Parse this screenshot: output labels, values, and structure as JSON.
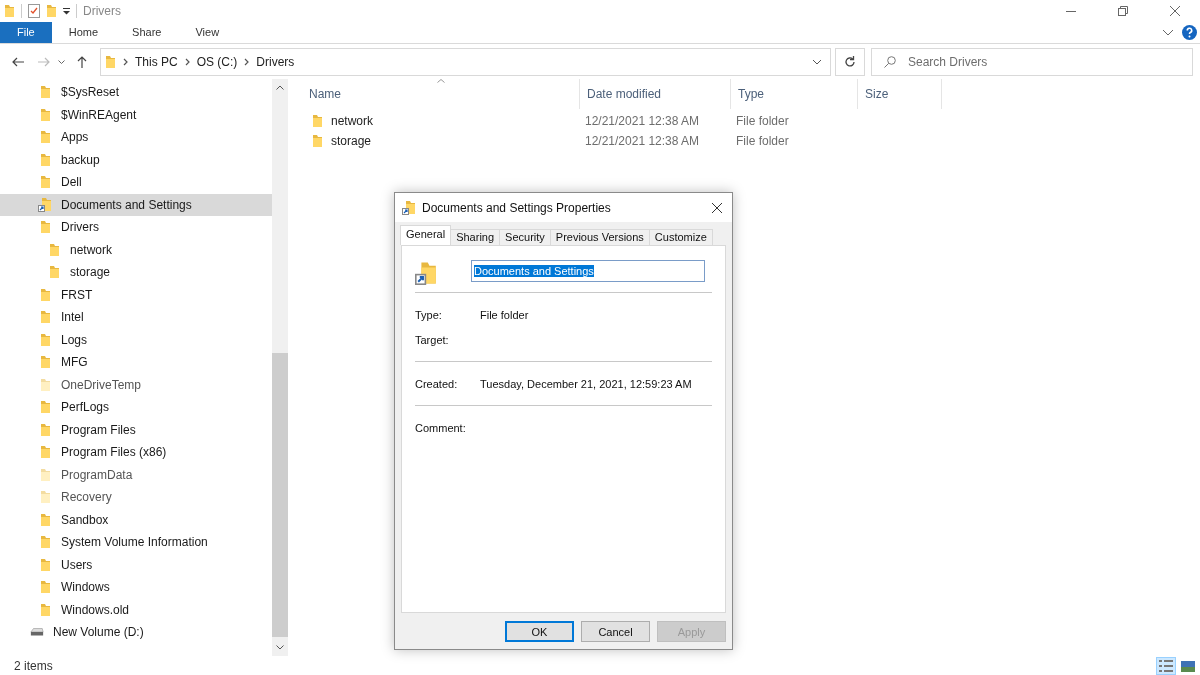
{
  "window": {
    "title": "Drivers"
  },
  "ribbon": {
    "tabs": [
      {
        "label": "File",
        "selected": true
      },
      {
        "label": "Home",
        "selected": false
      },
      {
        "label": "Share",
        "selected": false
      },
      {
        "label": "View",
        "selected": false
      }
    ]
  },
  "address_bar": {
    "path": [
      "This PC",
      "OS (C:)",
      "Drivers"
    ]
  },
  "search": {
    "placeholder": "Search Drivers"
  },
  "sidebar": {
    "items": [
      {
        "label": "$SysReset",
        "kind": "folder",
        "hidden": false,
        "selected": false
      },
      {
        "label": "$WinREAgent",
        "kind": "folder",
        "hidden": false,
        "selected": false
      },
      {
        "label": "Apps",
        "kind": "folder",
        "hidden": false,
        "selected": false
      },
      {
        "label": "backup",
        "kind": "folder",
        "hidden": false,
        "selected": false
      },
      {
        "label": "Dell",
        "kind": "folder",
        "hidden": false,
        "selected": false
      },
      {
        "label": "Documents and Settings",
        "kind": "shortcut",
        "hidden": false,
        "selected": true
      },
      {
        "label": "Drivers",
        "kind": "folder",
        "hidden": false,
        "selected": false,
        "children": [
          {
            "label": "network",
            "kind": "folder",
            "hidden": false,
            "selected": false
          },
          {
            "label": "storage",
            "kind": "folder",
            "hidden": false,
            "selected": false
          }
        ]
      },
      {
        "label": "FRST",
        "kind": "folder",
        "hidden": false,
        "selected": false
      },
      {
        "label": "Intel",
        "kind": "folder",
        "hidden": false,
        "selected": false
      },
      {
        "label": "Logs",
        "kind": "folder",
        "hidden": false,
        "selected": false
      },
      {
        "label": "MFG",
        "kind": "folder",
        "hidden": false,
        "selected": false
      },
      {
        "label": "OneDriveTemp",
        "kind": "folder",
        "hidden": true,
        "selected": false
      },
      {
        "label": "PerfLogs",
        "kind": "folder",
        "hidden": false,
        "selected": false
      },
      {
        "label": "Program Files",
        "kind": "folder",
        "hidden": false,
        "selected": false
      },
      {
        "label": "Program Files (x86)",
        "kind": "folder",
        "hidden": false,
        "selected": false
      },
      {
        "label": "ProgramData",
        "kind": "folder",
        "hidden": true,
        "selected": false
      },
      {
        "label": "Recovery",
        "kind": "folder",
        "hidden": true,
        "selected": false
      },
      {
        "label": "Sandbox",
        "kind": "folder",
        "hidden": false,
        "selected": false
      },
      {
        "label": "System Volume Information",
        "kind": "folder",
        "hidden": false,
        "selected": false
      },
      {
        "label": "Users",
        "kind": "folder",
        "hidden": false,
        "selected": false
      },
      {
        "label": "Windows",
        "kind": "folder",
        "hidden": false,
        "selected": false
      },
      {
        "label": "Windows.old",
        "kind": "folder",
        "hidden": false,
        "selected": false
      },
      {
        "label": "New Volume (D:)",
        "kind": "drive",
        "hidden": false,
        "selected": false
      }
    ]
  },
  "file_list": {
    "columns": [
      "Name",
      "Date modified",
      "Type",
      "Size"
    ],
    "rows": [
      {
        "name": "network",
        "date_modified": "12/21/2021 12:38 AM",
        "type": "File folder"
      },
      {
        "name": "storage",
        "date_modified": "12/21/2021 12:38 AM",
        "type": "File folder"
      }
    ]
  },
  "status_bar": {
    "item_count": "2 items"
  },
  "properties_dialog": {
    "title": "Documents and Settings Properties",
    "tabs": [
      {
        "label": "General",
        "selected": true
      },
      {
        "label": "Sharing",
        "selected": false
      },
      {
        "label": "Security",
        "selected": false
      },
      {
        "label": "Previous Versions",
        "selected": false
      },
      {
        "label": "Customize",
        "selected": false
      }
    ],
    "name_value": "Documents and Settings",
    "name_selected": true,
    "sections": [
      [
        {
          "label": "Type:",
          "value": "File folder"
        },
        {
          "label": "Target:"
        }
      ],
      [
        {
          "label": "Created:",
          "value": "Tuesday, December 21, 2021, 12:59:23 AM"
        }
      ],
      [
        {
          "label": "Comment:"
        }
      ]
    ],
    "buttons": [
      {
        "label": "OK",
        "default": true,
        "disabled": false
      },
      {
        "label": "Cancel",
        "default": false,
        "disabled": false
      },
      {
        "label": "Apply",
        "default": false,
        "disabled": true
      }
    ]
  }
}
